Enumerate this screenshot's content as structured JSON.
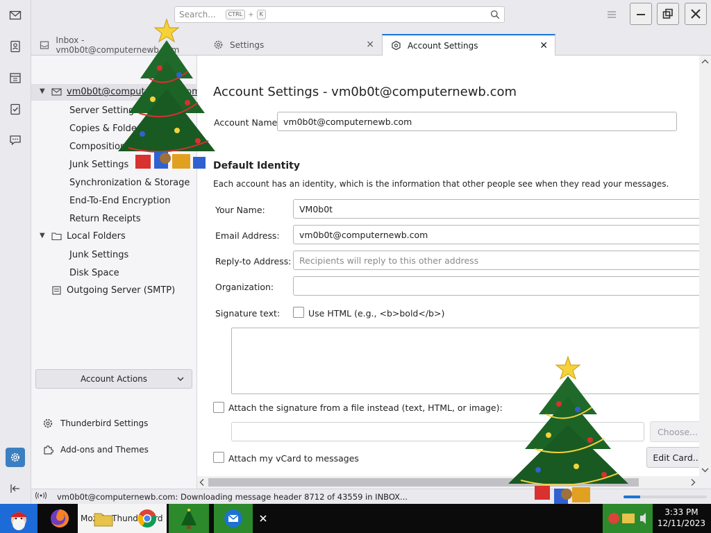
{
  "spaces": {
    "items": [
      {
        "name": "mail-icon"
      },
      {
        "name": "address-book-icon"
      },
      {
        "name": "calendar-icon"
      },
      {
        "name": "tasks-icon"
      },
      {
        "name": "chat-icon"
      },
      {
        "name": "settings-icon"
      },
      {
        "name": "collapse-icon"
      }
    ]
  },
  "titlebar": {
    "search_placeholder": "Search...",
    "shortcut_key1": "CTRL",
    "shortcut_plus": "+",
    "shortcut_key2": "K"
  },
  "tabs": [
    {
      "label": "Inbox - vm0b0t@computernewb.com",
      "icon": "inbox-icon"
    },
    {
      "label": "Settings",
      "icon": "gear-icon",
      "close": "×"
    },
    {
      "label": "Account Settings",
      "icon": "account-settings-icon",
      "close": "✕"
    }
  ],
  "tree": {
    "account": "vm0b0t@computernewb.com",
    "account_items": [
      "Server Settings",
      "Copies & Folders",
      "Composition & Addressing",
      "Junk Settings",
      "Synchronization & Storage",
      "End-To-End Encryption",
      "Return Receipts"
    ],
    "local_folders": "Local Folders",
    "local_items": [
      "Junk Settings",
      "Disk Space"
    ],
    "smtp": "Outgoing Server (SMTP)",
    "account_actions": "Account Actions",
    "thunderbird_settings": "Thunderbird Settings",
    "addons": "Add-ons and Themes"
  },
  "main": {
    "heading": "Account Settings - vm0b0t@computernewb.com",
    "account_name_label": "Account Name:",
    "account_name_value": "vm0b0t@computernewb.com",
    "identity_title": "Default Identity",
    "identity_desc": "Each account has an identity, which is the information that other people see when they read your messages.",
    "your_name_label": "Your Name:",
    "your_name_value": "VM0b0t",
    "email_label": "Email Address:",
    "email_value": "vm0b0t@computernewb.com",
    "replyto_label": "Reply-to Address:",
    "replyto_placeholder": "Recipients will reply to this other address",
    "org_label": "Organization:",
    "org_value": "",
    "signature_label": "Signature text:",
    "use_html_label": "Use HTML (e.g., <b>bold</b>)",
    "attach_sig_label": "Attach the signature from a file instead (text, HTML, or image):",
    "choose_label": "Choose...",
    "vcard_label": "Attach my vCard to messages",
    "edit_card_label": "Edit Card..."
  },
  "status": {
    "text": "vm0b0t@computernewb.com: Downloading message header 8712 of 43559 in INBOX...",
    "progress_fraction": 0.2
  },
  "taskbar": {
    "items": [
      {
        "name": "start-santa-icon"
      },
      {
        "name": "firefox-icon"
      },
      {
        "name": "thunderbird-task",
        "label": "Mozilla Thunderbird"
      },
      {
        "name": "chrome-icon"
      },
      {
        "name": "christmas-tree-app-icon"
      },
      {
        "name": "thunderbird-icon"
      }
    ],
    "time": "3:33 PM",
    "date": "12/11/2023"
  }
}
